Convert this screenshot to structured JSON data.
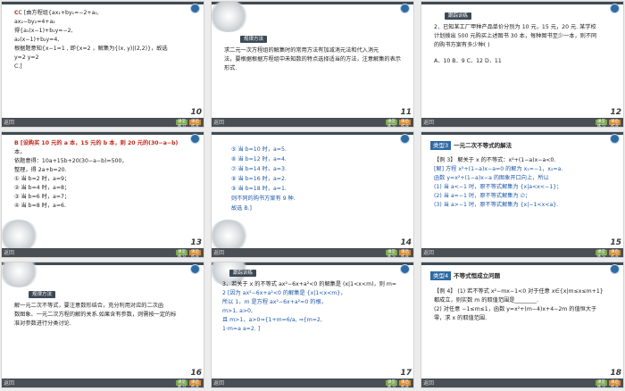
{
  "slides": [
    {
      "number": "10",
      "lines": [
        "C  [由方程组{ax₁+by₁=−2+a₁,",
        "             ax₂−by₂=4+a₂",
        "得{a₁(x−1)+b₁y=−2,",
        "   a₂(x−1)+b₂y=4,",
        "根据题意知{x−1=1 ,  即{x=2 ，解集为{(x, y)|(2,2)}，故选",
        "             y=2          y=2",
        "C.]"
      ]
    },
    {
      "number": "11",
      "tag": "规律方法",
      "lines": [
        "求二元一次方程组的解集时的常用方法有加减消元法和代入消元",
        "法，要根据根据方程组中未知数的特点选择适当的方法，注意解集的表示",
        "形式."
      ]
    },
    {
      "number": "12",
      "tag": "跟踪训练",
      "lines": [
        "2．已知某工厂甲种产品单价分别为 10 元，15 元，20 元. 某学校",
        "计划拨出 500 元购买上述图书 30 本，每种图书至少一本，则不同",
        "的购书方案有多少种(    )",
        "A．10        B．9     C．12      D．11"
      ]
    },
    {
      "number": "13",
      "lines": [
        "B  [设购买 10 元的 a 本，15 元的 b 本，则 20 元的(30−a−b)",
        "本，",
        "    依题意得：10a+15b+20(30−a−b)=500，",
        "    整理，得 2a+b=20.",
        "    ① 当 b=2 时，a=9；",
        "    ② 当 b=4 时，a=8；",
        "    ③ 当 b=6 时，a=7；",
        "    ④ 当 b=8 时，a=6."
      ]
    },
    {
      "number": "14",
      "lines": [
        "⑤ 当 b=10 时，a=5.",
        "⑥ 当 b=12 时，a=4.",
        "⑦ 当 b=14 时，a=3.",
        "⑧ 当 b=16 时，a=2.",
        "⑨ 当 b=18 时，a=1.",
        "则不同的购书方案有 9 种.",
        "故选 B.]"
      ]
    },
    {
      "number": "15",
      "category_num": "类型3",
      "category_name": "一元二次不等式的解法",
      "lines": [
        "【例 3】  解关于 x 的不等式：x²+(1−a)x−a<0.",
        "[解]  方程 x²+(1−a)x−a=0 的解为 x₁=−1，x₂=a.",
        "函数 y=x²+(1−a)x−a 的图象开口向上，所以",
        "(1) 当 a<−1 时，原不等式解集为 {x|a<x<−1}；",
        "(2) 当 a=−1 时，原不等式解集为 ∅；",
        "(3) 当 a>−1 时，原不等式解集为 {x|−1<x<a}."
      ]
    },
    {
      "number": "16",
      "tag": "规律方法",
      "lines": [
        "解一元二次不等式，要注意数形结合，充分利用对应的二次函",
        "数图象、一元二次方程的解的关系.如果含有参数，则需按一定的标",
        "准对参数进行分类讨论."
      ]
    },
    {
      "number": "17",
      "tag": "跟踪训练",
      "lines": [
        "3．若关于 x 的不等式 ax²−6x+a²<0 的解集是 (x|1<x<m)，则 m=",
        "2  [因为 ax²−6x+a²<0 的解集是 {x|1<x<m}，",
        "所以 1，m 是方程 ax²−6x+a²=0 的根，",
        "            m>1,   a>0,",
        "且 m>1，a>0⇒{1+m=6/a,  ⇒{m=2,",
        "             1·m=a            a=2.  ]"
      ]
    },
    {
      "number": "18",
      "category_num": "类型4",
      "category_name": "不等式恒成立问题",
      "lines": [
        "【例 4】  (1) 若不等式 x²−mx−1<0 对于任意 x∈{x|m≤x≤m+1}",
        "都成立，则实数 m 的取值范围是________.",
        "(2) 对任意 −1≤m≤1，函数 y=x²+(m−4)x+4−2m 的值恒大于",
        "零，求 x 的取值范围."
      ]
    }
  ],
  "bottom_buttons": {
    "green": "课堂练习",
    "orange": "课后作业"
  },
  "bottom_label": "返回"
}
